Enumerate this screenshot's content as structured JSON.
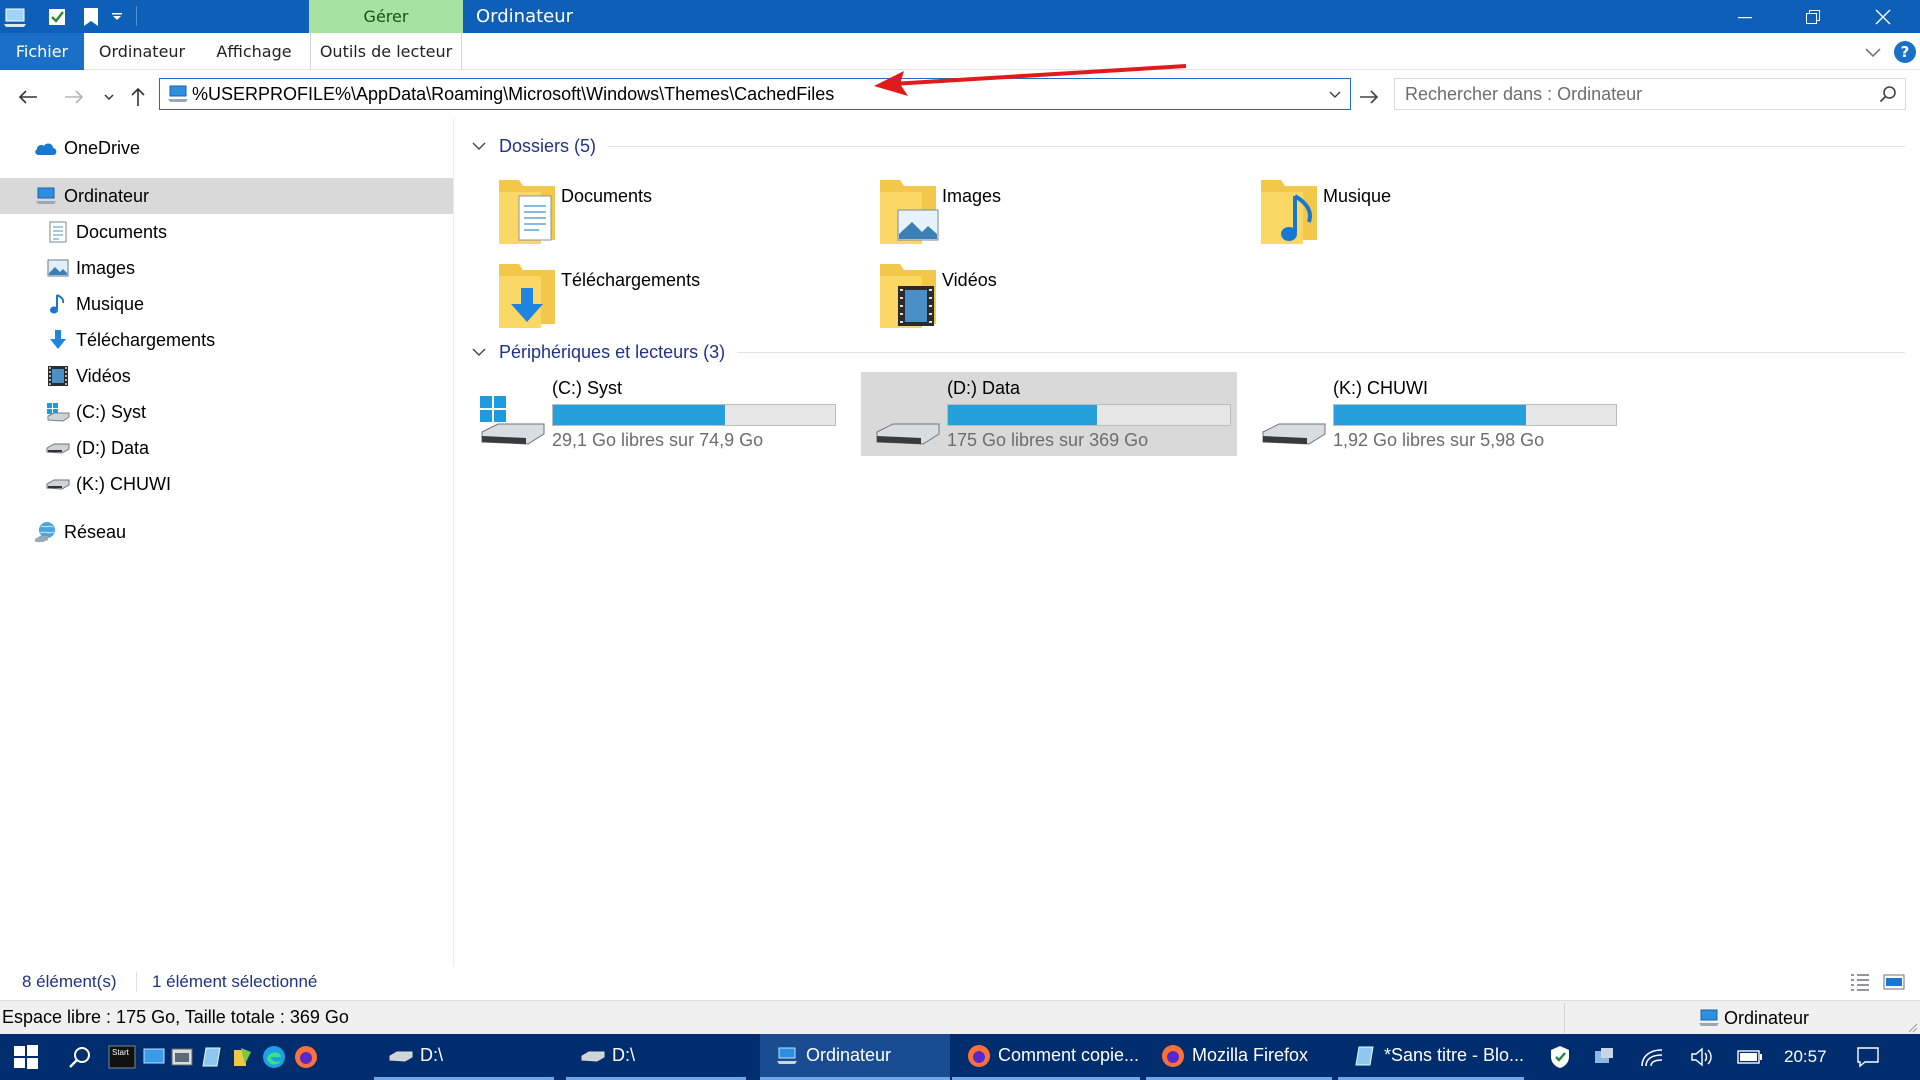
{
  "window": {
    "title": "Ordinateur",
    "manage_tab": "Gérer"
  },
  "ribbon": {
    "file_tab": "Fichier",
    "tabs": [
      "Ordinateur",
      "Affichage",
      "Outils de lecteur"
    ],
    "help_label": "?"
  },
  "navigation": {
    "address": "%USERPROFILE%\\AppData\\Roaming\\Microsoft\\Windows\\Themes\\CachedFiles",
    "search_placeholder": "Rechercher dans : Ordinateur"
  },
  "sidebar": {
    "items": [
      {
        "label": "OneDrive",
        "icon": "onedrive-icon"
      },
      {
        "label": "Ordinateur",
        "icon": "computer-icon",
        "selected": true
      },
      {
        "label": "Documents",
        "icon": "documents-icon"
      },
      {
        "label": "Images",
        "icon": "images-icon"
      },
      {
        "label": "Musique",
        "icon": "music-icon"
      },
      {
        "label": "Téléchargements",
        "icon": "downloads-icon"
      },
      {
        "label": "Vidéos",
        "icon": "videos-icon"
      },
      {
        "label": "(C:) Syst",
        "icon": "windows-drive-icon"
      },
      {
        "label": "(D:) Data",
        "icon": "drive-icon"
      },
      {
        "label": "(K:) CHUWI",
        "icon": "drive-icon"
      },
      {
        "label": "Réseau",
        "icon": "network-icon"
      }
    ]
  },
  "content": {
    "folders_group": "Dossiers (5)",
    "folders": [
      {
        "name": "Documents",
        "icon": "documents-folder-icon"
      },
      {
        "name": "Images",
        "icon": "images-folder-icon"
      },
      {
        "name": "Musique",
        "icon": "music-folder-icon"
      },
      {
        "name": "Téléchargements",
        "icon": "downloads-folder-icon"
      },
      {
        "name": "Vidéos",
        "icon": "videos-folder-icon"
      }
    ],
    "drives_group": "Périphériques et lecteurs (3)",
    "drives": [
      {
        "name": "(C:) Syst",
        "info": "29,1 Go libres sur 74,9 Go",
        "used_fraction": 0.61,
        "selected": false,
        "icon": "windows-drive-icon"
      },
      {
        "name": "(D:) Data",
        "info": "175 Go libres sur 369 Go",
        "used_fraction": 0.53,
        "selected": true,
        "icon": "drive-icon"
      },
      {
        "name": "(K:) CHUWI",
        "info": "1,92 Go libres sur 5,98 Go",
        "used_fraction": 0.68,
        "selected": false,
        "icon": "drive-icon"
      }
    ]
  },
  "status": {
    "count": "8 élément(s)",
    "selected": "1 élément sélectionné"
  },
  "details": {
    "text": "Espace libre : 175 Go, Taille totale : 369 Go",
    "location": "Ordinateur"
  },
  "taskbar": {
    "start_label": "Start",
    "apps": [
      {
        "label": "D:\\",
        "icon": "drive-icon",
        "active": false
      },
      {
        "label": "D:\\",
        "icon": "drive-icon",
        "active": false
      },
      {
        "label": "Ordinateur",
        "icon": "computer-icon",
        "active": true
      },
      {
        "label": "Comment copie...",
        "icon": "firefox-icon",
        "active": false
      },
      {
        "label": "Mozilla Firefox",
        "icon": "firefox-icon",
        "active": false
      },
      {
        "label": "*Sans titre - Blo...",
        "icon": "notepad-icon",
        "active": false
      }
    ],
    "time": "20:57"
  },
  "colors": {
    "titlebar": "#0d5fb8",
    "manage_tab": "#a6e3a0",
    "accent": "#1a6fc6",
    "drive_fill": "#26a0da",
    "group_title": "#1e3287",
    "taskbar": "#002d6e",
    "annotation_arrow": "#e11b1b"
  }
}
